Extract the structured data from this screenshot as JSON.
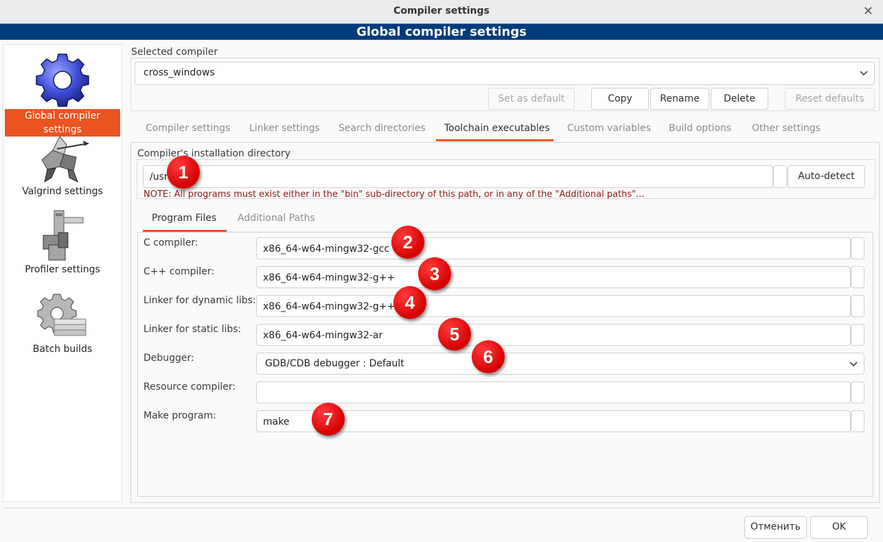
{
  "window": {
    "title": "Compiler settings",
    "banner": "Global compiler settings"
  },
  "sidebar": {
    "items": [
      {
        "label": "Global compiler settings",
        "icon": "gear-icon",
        "selected": true
      },
      {
        "label": "Valgrind settings",
        "icon": "knight-icon"
      },
      {
        "label": "Profiler settings",
        "icon": "caliper-icon"
      },
      {
        "label": "Batch builds",
        "icon": "gear-stack-icon"
      }
    ]
  },
  "selected_compiler": {
    "label": "Selected compiler",
    "value": "cross_windows"
  },
  "compiler_buttons": {
    "set_default": "Set as default",
    "copy": "Copy",
    "rename": "Rename",
    "delete": "Delete",
    "reset_defaults": "Reset defaults"
  },
  "tabs": [
    {
      "label": "Compiler settings"
    },
    {
      "label": "Linker settings"
    },
    {
      "label": "Search directories"
    },
    {
      "label": "Toolchain executables",
      "active": true
    },
    {
      "label": "Custom variables"
    },
    {
      "label": "Build options"
    },
    {
      "label": "Other settings"
    }
  ],
  "install_dir": {
    "label": "Compiler's installation directory",
    "value": "/usr",
    "auto_detect": "Auto-detect",
    "note": "NOTE: All programs must exist either in the \"bin\" sub-directory of this path, or in any of the \"Additional paths\"..."
  },
  "subtabs": [
    {
      "label": "Program Files",
      "active": true
    },
    {
      "label": "Additional Paths"
    }
  ],
  "programs": {
    "c_compiler": {
      "label": "C compiler:",
      "value": "x86_64-w64-mingw32-gcc"
    },
    "cpp_compiler": {
      "label": "C++ compiler:",
      "value": "x86_64-w64-mingw32-g++"
    },
    "linker_dynamic": {
      "label": "Linker for dynamic libs:",
      "value": "x86_64-w64-mingw32-g++"
    },
    "linker_static": {
      "label": "Linker for static libs:",
      "value": "x86_64-w64-mingw32-ar"
    },
    "debugger": {
      "label": "Debugger:",
      "value": "GDB/CDB debugger : Default"
    },
    "resource_compiler": {
      "label": "Resource compiler:",
      "value": ""
    },
    "make_program": {
      "label": "Make program:",
      "value": "make"
    }
  },
  "annotations": [
    "1",
    "2",
    "3",
    "4",
    "5",
    "6",
    "7"
  ],
  "footer": {
    "cancel": "Отменить",
    "ok": "OK"
  },
  "colors": {
    "accent": "#e95420",
    "banner": "#003b7a",
    "badge": "#d40000",
    "note": "#8b1a1a"
  }
}
